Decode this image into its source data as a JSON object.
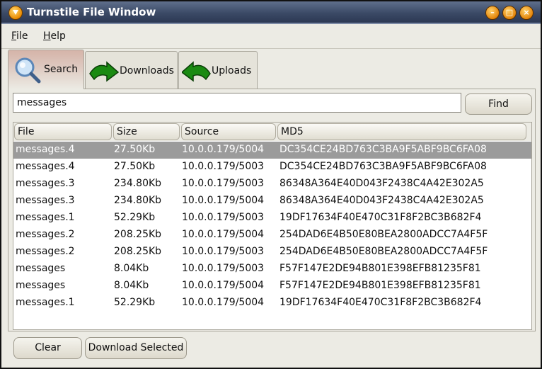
{
  "window": {
    "title": "Turnstile File Window"
  },
  "menu": {
    "file": "F",
    "file_rest": "ile",
    "help": "H",
    "help_rest": "elp"
  },
  "tabs": [
    {
      "label": "Search",
      "icon": "magnifier-icon"
    },
    {
      "label": "Downloads",
      "icon": "green-arrow-down-icon"
    },
    {
      "label": "Uploads",
      "icon": "green-arrow-up-icon"
    }
  ],
  "search": {
    "value": "messages",
    "find_label": "Find"
  },
  "table": {
    "headers": [
      "File",
      "Size",
      "Source",
      "MD5"
    ],
    "rows": [
      [
        "messages.4",
        "27.50Kb",
        "10.0.0.179/5004",
        "DC354CE24BD763C3BA9F5ABF9BC6FA08"
      ],
      [
        "messages.4",
        "27.50Kb",
        "10.0.0.179/5003",
        "DC354CE24BD763C3BA9F5ABF9BC6FA08"
      ],
      [
        "messages.3",
        "234.80Kb",
        "10.0.0.179/5003",
        "86348A364E40D043F2438C4A42E302A5"
      ],
      [
        "messages.3",
        "234.80Kb",
        "10.0.0.179/5004",
        "86348A364E40D043F2438C4A42E302A5"
      ],
      [
        "messages.1",
        "52.29Kb",
        "10.0.0.179/5003",
        "19DF17634F40E470C31F8F2BC3B682F4"
      ],
      [
        "messages.2",
        "208.25Kb",
        "10.0.0.179/5004",
        "254DAD6E4B50E80BEA2800ADCC7A4F5F"
      ],
      [
        "messages.2",
        "208.25Kb",
        "10.0.0.179/5003",
        "254DAD6E4B50E80BEA2800ADCC7A4F5F"
      ],
      [
        "messages",
        "8.04Kb",
        "10.0.0.179/5003",
        "F57F147E2DE94B801E398EFB81235F81"
      ],
      [
        "messages",
        "8.04Kb",
        "10.0.0.179/5004",
        "F57F147E2DE94B801E398EFB81235F81"
      ],
      [
        "messages.1",
        "52.29Kb",
        "10.0.0.179/5004",
        "19DF17634F40E470C31F8F2BC3B682F4"
      ]
    ]
  },
  "buttons": {
    "clear": "Clear",
    "download_selected": "Download Selected"
  },
  "colors": {
    "titlebar": "#3b4a66",
    "selected_row": "#9b9b9b",
    "accent_orange": "#e98a00",
    "arrow_green": "#1a8a12"
  }
}
